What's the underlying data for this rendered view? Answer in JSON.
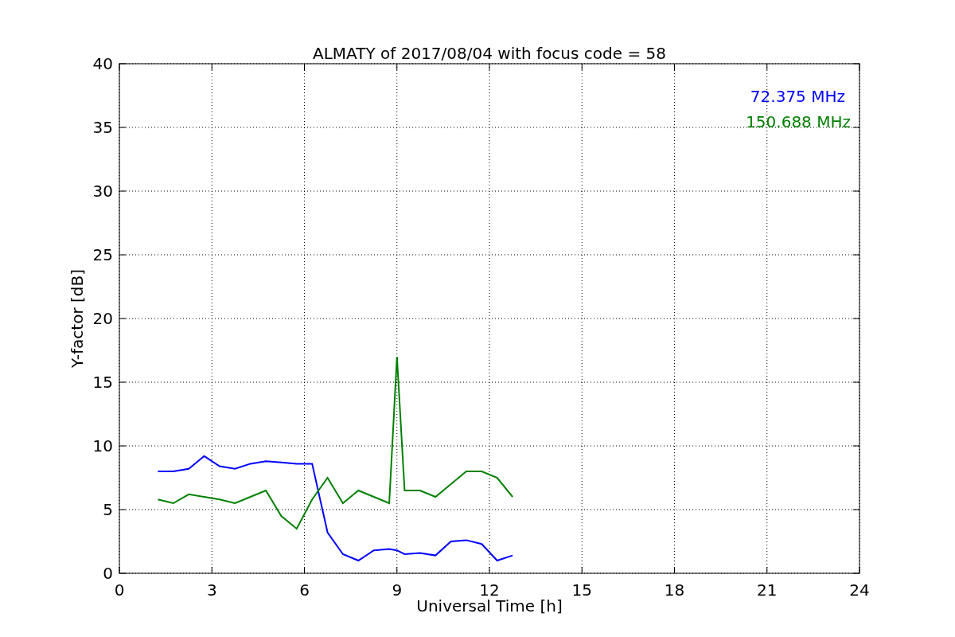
{
  "chart_data": {
    "type": "line",
    "title": "ALMATY of 2017/08/04 with focus code = 58",
    "xlabel": "Universal Time [h]",
    "ylabel": "Y-factor [dB]",
    "x": [
      1.25,
      1.75,
      2.25,
      2.75,
      3.25,
      3.75,
      4.25,
      4.75,
      5.25,
      5.75,
      6.25,
      6.75,
      7.25,
      7.75,
      8.25,
      8.75,
      9.0,
      9.25,
      9.75,
      10.25,
      10.75,
      11.25,
      11.75,
      12.25,
      12.75
    ],
    "series": [
      {
        "name": "72.375 MHz",
        "color": "#0000ff",
        "values": [
          8,
          8,
          8.2,
          9.2,
          8.4,
          8.2,
          8.6,
          8.8,
          8.7,
          8.6,
          8.6,
          3.2,
          1.5,
          1.0,
          1.8,
          1.9,
          1.8,
          1.5,
          1.6,
          1.4,
          2.5,
          2.6,
          2.3,
          1.0,
          1.4
        ]
      },
      {
        "name": "150.688 MHz",
        "color": "#008000",
        "values": [
          5.8,
          5.5,
          6.2,
          6.0,
          5.8,
          5.5,
          6.0,
          6.5,
          4.5,
          3.5,
          5.8,
          7.5,
          5.5,
          6.5,
          6.0,
          5.5,
          17,
          6.5,
          6.5,
          6.0,
          7.0,
          8.0,
          8.0,
          7.5,
          6.0
        ]
      }
    ],
    "xlim": [
      0,
      24
    ],
    "ylim": [
      0,
      40
    ],
    "xticks": [
      0,
      3,
      6,
      9,
      12,
      15,
      18,
      21,
      24
    ],
    "yticks": [
      0,
      5,
      10,
      15,
      20,
      25,
      30,
      35,
      40
    ],
    "grid": true
  }
}
